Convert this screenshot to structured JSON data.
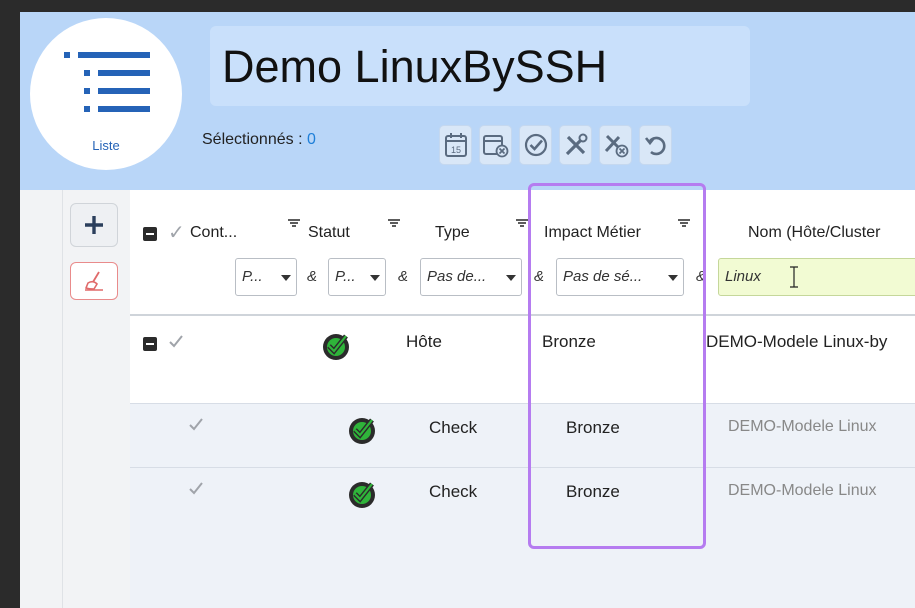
{
  "app": {
    "logo_label": "Liste",
    "title": "Demo LinuxBySSH",
    "selected_label": "Sélectionnés : ",
    "selected_count": "0",
    "toolbar_icons": [
      "calendar-15-icon",
      "calendar-cancel-icon",
      "check-circle-icon",
      "tools-icon",
      "tools-cancel-icon",
      "undo-icon"
    ]
  },
  "grid": {
    "columns": [
      {
        "key": "ack",
        "label": "✓"
      },
      {
        "key": "cont",
        "label": "Cont..."
      },
      {
        "key": "statut",
        "label": "Statut"
      },
      {
        "key": "type",
        "label": "Type"
      },
      {
        "key": "impact",
        "label": "Impact Métier"
      },
      {
        "key": "nom",
        "label": "Nom (Hôte/Cluster"
      }
    ],
    "filters": {
      "cont": "P...",
      "statut": "P...",
      "type": "Pas de...",
      "impact": "Pas de sé...",
      "nom": "Linux",
      "amp": "&"
    },
    "rows": [
      {
        "type": "Hôte",
        "impact": "Bronze",
        "nom": "DEMO-Modele Linux-by"
      },
      {
        "type": "Check",
        "impact": "Bronze",
        "nom": "DEMO-Modele Linux"
      },
      {
        "type": "Check",
        "impact": "Bronze",
        "nom": "DEMO-Modele Linux"
      }
    ]
  },
  "colors": {
    "header_bg": "#b9d6f8",
    "accent": "#1e7fd8",
    "highlight": "#b57cf0",
    "status_ok": "#2fb43a"
  }
}
